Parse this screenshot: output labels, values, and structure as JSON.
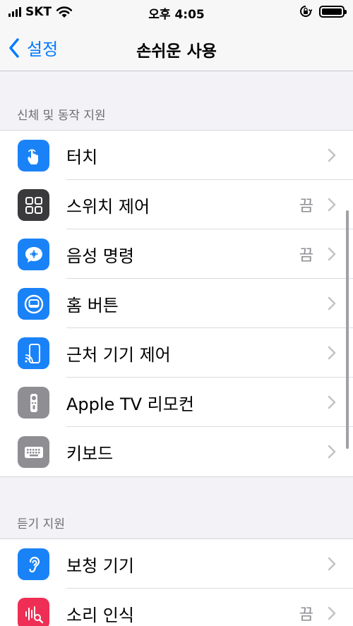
{
  "status_bar": {
    "carrier": "SKT",
    "time": "오후 4:05"
  },
  "nav": {
    "back_label": "설정",
    "title": "손쉬운 사용"
  },
  "sections": [
    {
      "header": "신체 및 동작 지원",
      "items": [
        {
          "label": "터치",
          "value": "",
          "icon": "hand-touch-icon",
          "color": "#1a82f7"
        },
        {
          "label": "스위치 제어",
          "value": "끔",
          "icon": "switch-control-icon",
          "color": "#3a3a3c"
        },
        {
          "label": "음성 명령",
          "value": "끔",
          "icon": "voice-control-icon",
          "color": "#1a82f7"
        },
        {
          "label": "홈 버튼",
          "value": "",
          "icon": "home-button-icon",
          "color": "#1a82f7"
        },
        {
          "label": "근처 기기 제어",
          "value": "",
          "icon": "nearby-devices-icon",
          "color": "#1a82f7"
        },
        {
          "label": "Apple TV 리모컨",
          "value": "",
          "icon": "tv-remote-icon",
          "color": "#8e8e93"
        },
        {
          "label": "키보드",
          "value": "",
          "icon": "keyboard-icon",
          "color": "#8e8e93"
        }
      ]
    },
    {
      "header": "듣기 지원",
      "items": [
        {
          "label": "보청 기기",
          "value": "",
          "icon": "hearing-ear-icon",
          "color": "#1a82f7"
        },
        {
          "label": "소리 인식",
          "value": "끔",
          "icon": "sound-recognition-icon",
          "color": "#ef2e55"
        }
      ]
    }
  ]
}
